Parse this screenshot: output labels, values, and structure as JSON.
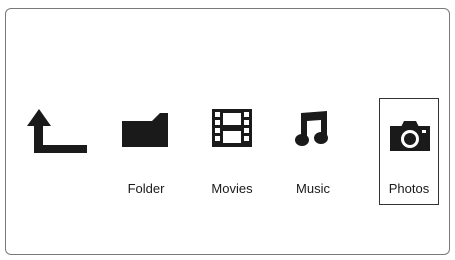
{
  "menu": {
    "items": [
      {
        "id": "back",
        "label": "",
        "icon": "back-arrow-icon"
      },
      {
        "id": "folder",
        "label": "Folder",
        "icon": "folder-icon"
      },
      {
        "id": "movies",
        "label": "Movies",
        "icon": "film-icon"
      },
      {
        "id": "music",
        "label": "Music",
        "icon": "music-note-icon"
      },
      {
        "id": "photos",
        "label": "Photos",
        "icon": "camera-icon",
        "selected": true
      }
    ]
  },
  "colors": {
    "icon": "#1a1a1a",
    "frame_border": "#7a7a7a",
    "selection_border": "#333333",
    "background": "#ffffff"
  }
}
